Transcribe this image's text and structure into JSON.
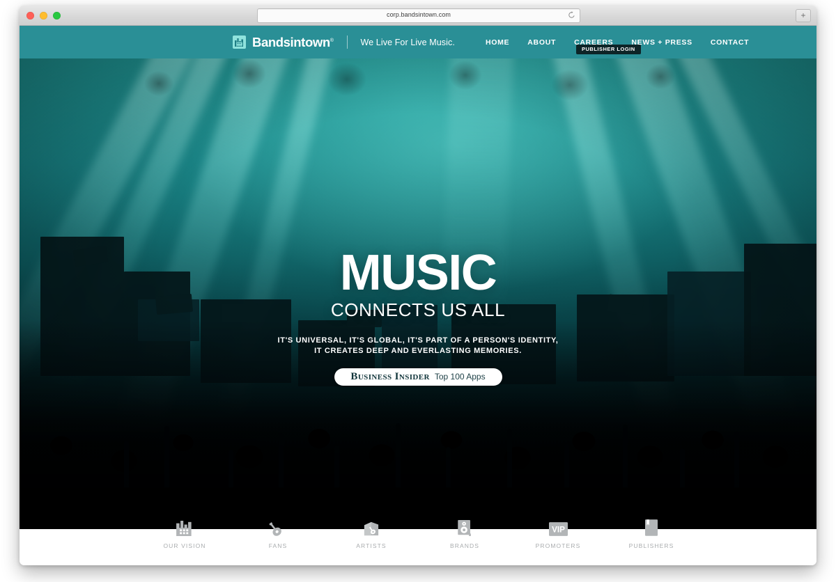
{
  "browser": {
    "url": "corp.bandsintown.com",
    "reload_icon": "reload-icon",
    "newtab_label": "+",
    "traffic_lights": [
      "close",
      "minimize",
      "maximize"
    ]
  },
  "nav": {
    "logo_icon": "bandsintown-logo-icon",
    "brand": "Bandsintown",
    "brand_registered": "®",
    "tagline": "We Live For Live Music.",
    "links": [
      {
        "label": "HOME"
      },
      {
        "label": "ABOUT"
      },
      {
        "label": "CAREERS"
      },
      {
        "label": "NEWS + PRESS"
      },
      {
        "label": "CONTACT"
      }
    ],
    "publisher_login": "PUBLISHER LOGIN",
    "bar_color": "#2a8f96"
  },
  "hero": {
    "headline": "MUSIC",
    "subhead": "CONNECTS US ALL",
    "lede_line1": "IT'S UNIVERSAL, IT'S GLOBAL, IT'S PART OF A PERSON'S IDENTITY,",
    "lede_line2": "IT CREATES DEEP AND EVERLASTING MEMORIES.",
    "badge": {
      "name": "Business Insider",
      "subtitle": "Top 100 Apps"
    }
  },
  "footer": {
    "items": [
      {
        "label": "OUR VISION",
        "icon": "factory-building-icon"
      },
      {
        "label": "FANS",
        "icon": "guitar-icon"
      },
      {
        "label": "ARTISTS",
        "icon": "guitar-case-icon"
      },
      {
        "label": "BRANDS",
        "icon": "speaker-cabinet-icon"
      },
      {
        "label": "PROMOTERS",
        "icon": "vip-pass-icon"
      },
      {
        "label": "PUBLISHERS",
        "icon": "book-icon"
      }
    ]
  },
  "colors": {
    "teal": "#2a8f96",
    "logo_mint": "#8fe3dd",
    "badge_dark": "#0d2427",
    "footer_gray": "#a9acae"
  }
}
